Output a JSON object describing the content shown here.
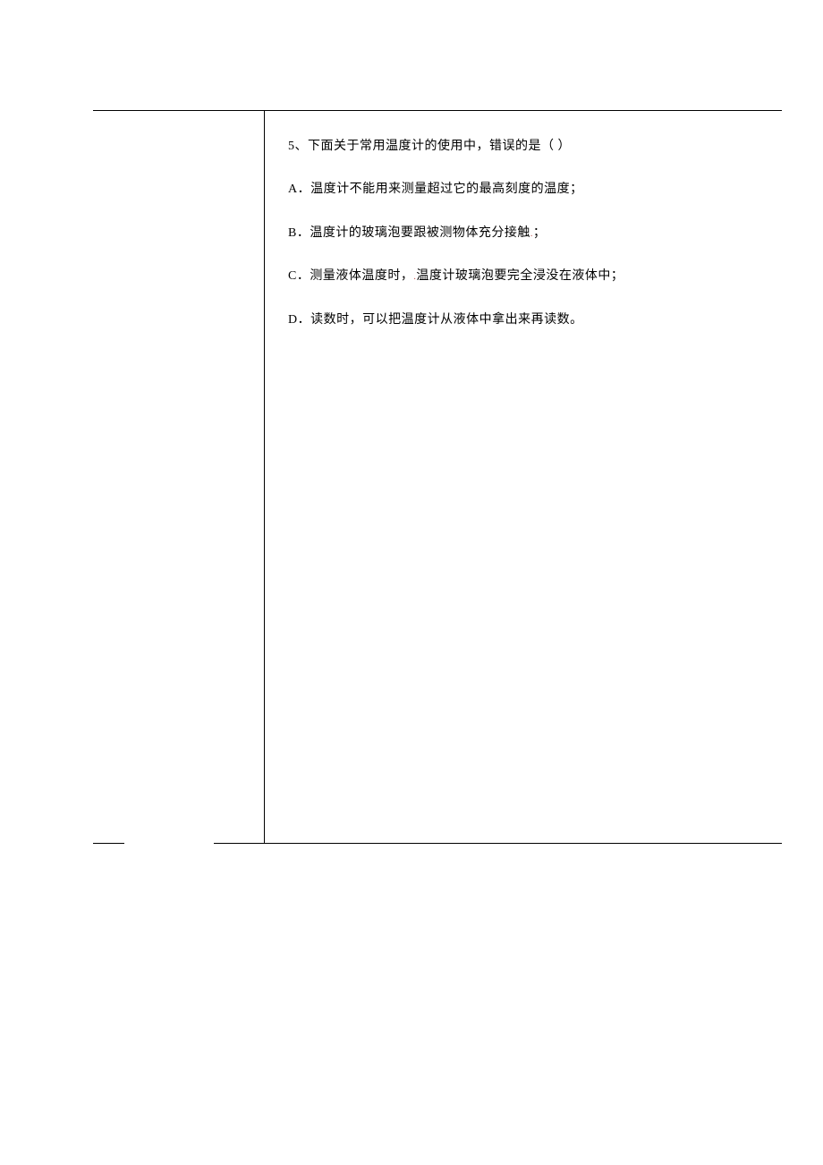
{
  "question": {
    "number": "5、",
    "stem": "下面关于常用温度计的使用中，错误的是（   ）",
    "options": {
      "A": "A．温度计不能用来测量超过它的最高刻度的温度；",
      "B_prefix": "B．温度计的玻璃泡要跟被测物体充分接触",
      "B_suffix": "；",
      "C_prefix": "C．测量液体温度时，",
      "C_suffix": "温度计玻璃泡要完全浸没在液体中；",
      "D": "D．读数时，可以把温度计从液体中拿出来再读数。"
    }
  }
}
